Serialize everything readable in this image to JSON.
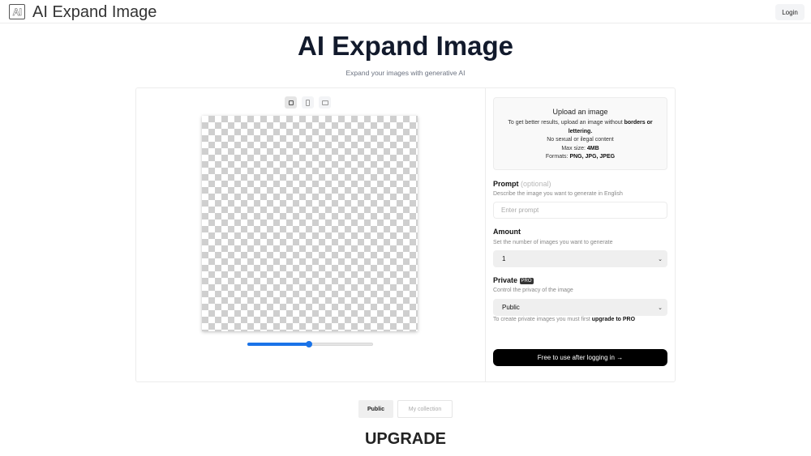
{
  "header": {
    "logo_glyph": "AI",
    "app_title": "AI Expand Image",
    "login_label": "Login"
  },
  "hero": {
    "title": "AI Expand Image",
    "subtitle": "Expand your images with generative AI"
  },
  "editor": {
    "aspect_ratios": [
      {
        "name": "square",
        "active": true
      },
      {
        "name": "portrait",
        "active": false
      },
      {
        "name": "landscape",
        "active": false
      }
    ],
    "zoom_slider_value": 0.49
  },
  "upload": {
    "title": "Upload an image",
    "line1_prefix": "To get better results, upload an image without ",
    "line1_bold": "borders or lettering.",
    "line2": "No sexual or ilegal content",
    "line3_prefix": "Max size: ",
    "line3_bold": "4MB",
    "line4_prefix": "Formats: ",
    "line4_bold": "PNG, JPG, JPEG"
  },
  "form": {
    "prompt": {
      "label": "Prompt",
      "optional": "(optional)",
      "description": "Describe the image you want to generate in English",
      "placeholder": "Enter prompt",
      "value": ""
    },
    "amount": {
      "label": "Amount",
      "description": "Set the number of images you want to generate",
      "selected": "1"
    },
    "private": {
      "label": "Private",
      "badge": "PRO",
      "description": "Control the privacy of the image",
      "selected": "Public",
      "hint_prefix": "To create private images you must first ",
      "hint_bold": "upgrade to PRO"
    },
    "submit_label": "Free to use after logging in →"
  },
  "gallery_tabs": [
    {
      "label": "Public",
      "active": true
    },
    {
      "label": "My collection",
      "active": false
    }
  ],
  "upgrade_heading": "UPGRADE",
  "colors": {
    "accent": "#1a73e8",
    "cta_bg": "#000000",
    "title": "#121a2c"
  }
}
